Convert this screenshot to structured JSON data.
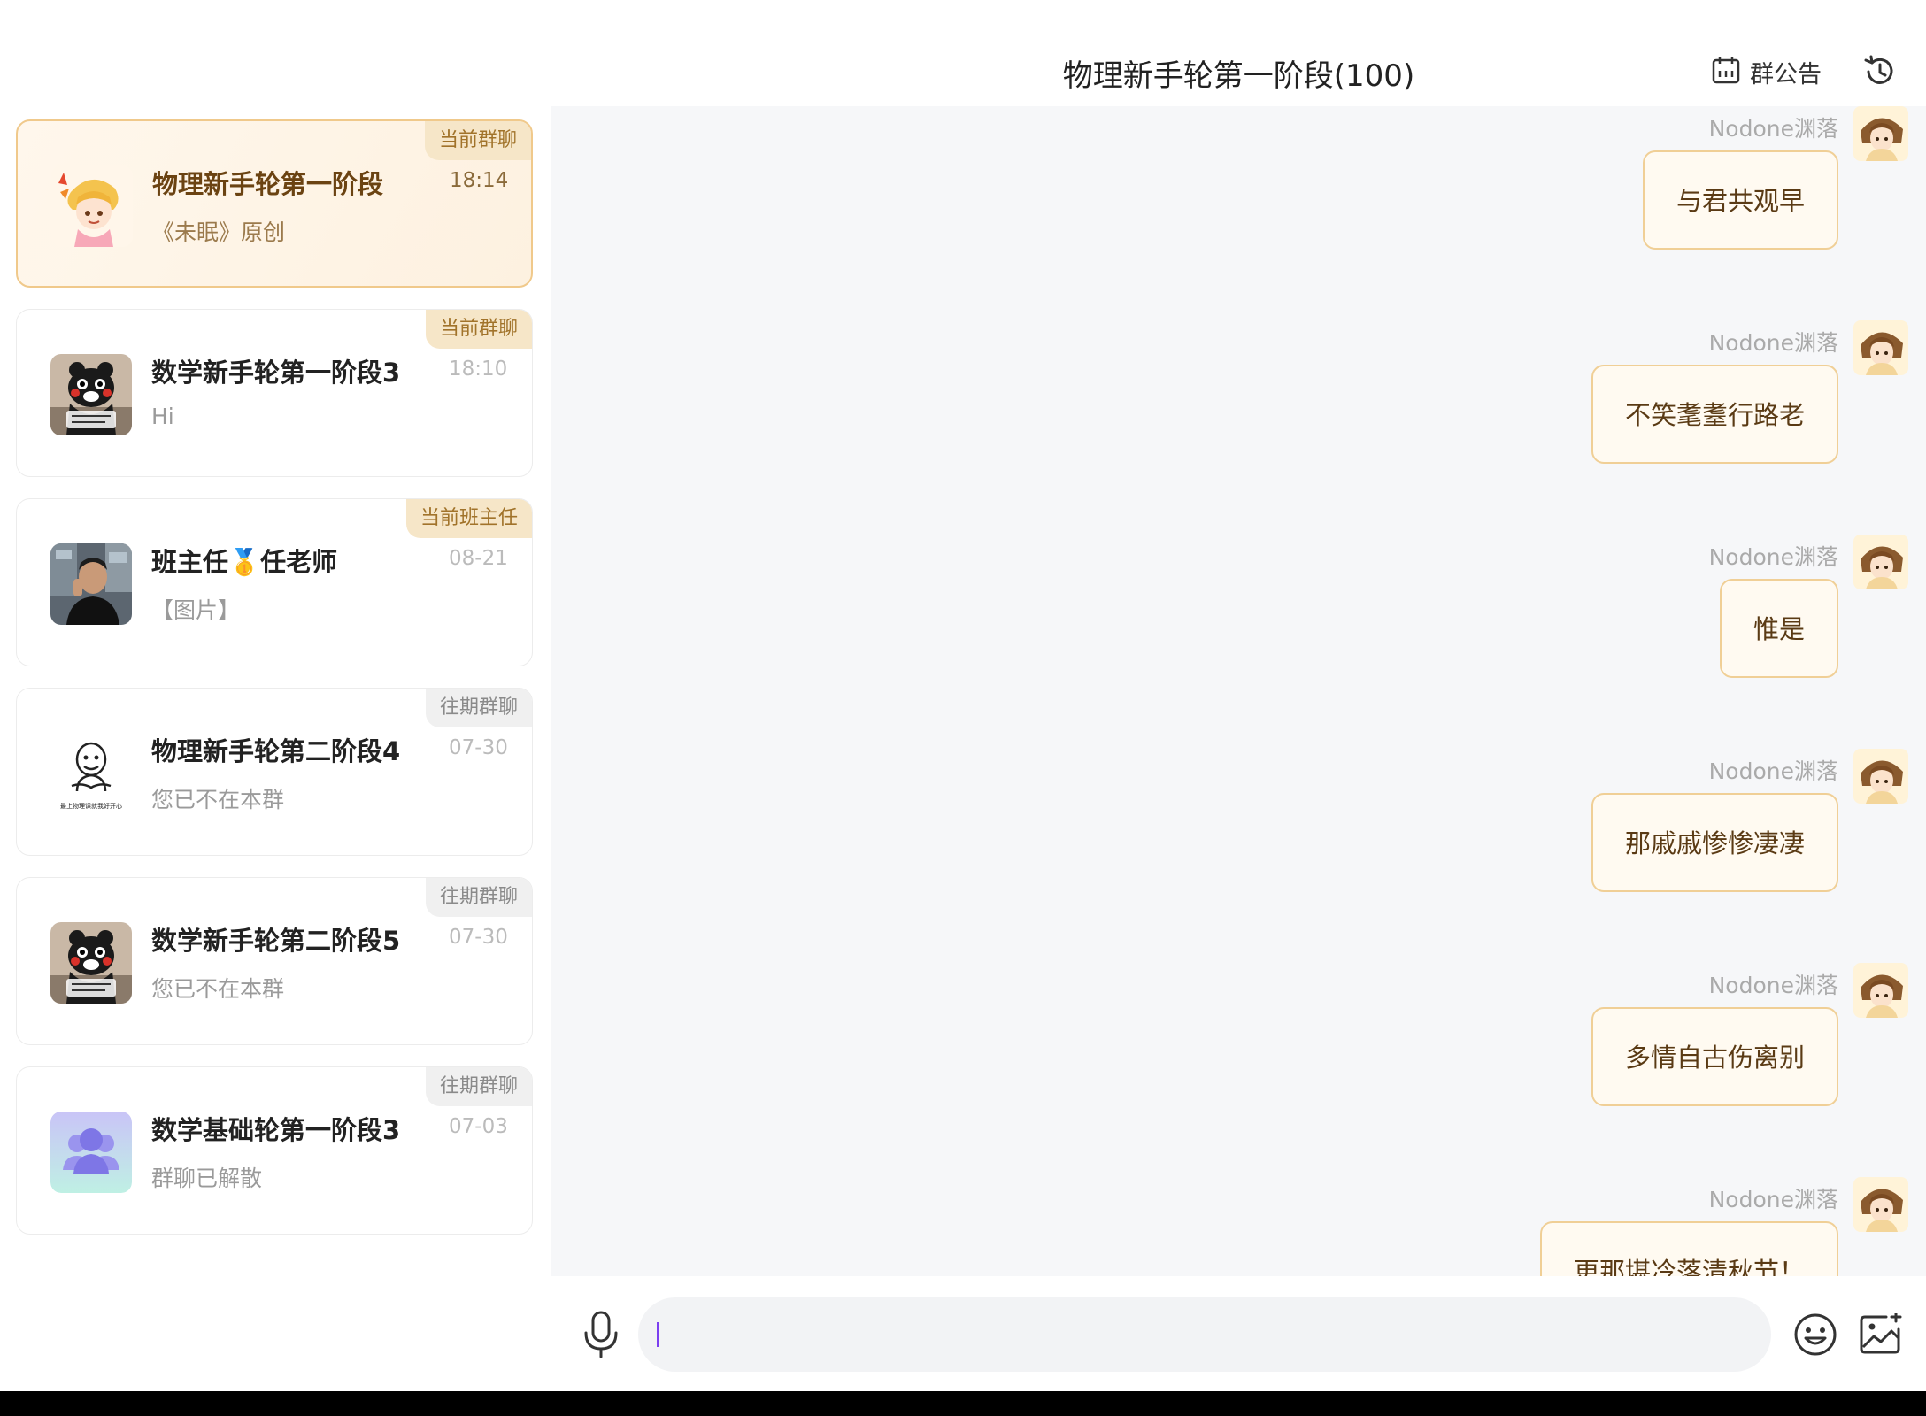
{
  "sidebar": {
    "conversations": [
      {
        "tag": "当前群聊",
        "tag_type": "current",
        "title": "物理新手轮第一阶段",
        "time": "18:14",
        "preview": "《未眠》原创",
        "avatar_icon": "anime-girl-avatar-icon",
        "active": true
      },
      {
        "tag": "当前群聊",
        "tag_type": "current",
        "title": "数学新手轮第一阶段3",
        "time": "18:10",
        "preview": "Hi",
        "avatar_icon": "kumamon-avatar-icon",
        "active": false
      },
      {
        "tag": "当前班主任",
        "tag_type": "current",
        "title": "班主任🥇任老师",
        "time": "08-21",
        "preview": "【图片】",
        "avatar_icon": "teacher-photo-avatar-icon",
        "active": false
      },
      {
        "tag": "往期群聊",
        "tag_type": "past",
        "title": "物理新手轮第二阶段4",
        "time": "07-30",
        "preview": "您已不在本群",
        "avatar_icon": "meme-sketch-avatar-icon",
        "avatar_caption": "最上物理课就我好开心",
        "active": false
      },
      {
        "tag": "往期群聊",
        "tag_type": "past",
        "title": "数学新手轮第二阶段5",
        "time": "07-30",
        "preview": "您已不在本群",
        "avatar_icon": "kumamon-avatar-icon",
        "active": false
      },
      {
        "tag": "往期群聊",
        "tag_type": "past",
        "title": "数学基础轮第一阶段3",
        "time": "07-03",
        "preview": "群聊已解散",
        "avatar_icon": "group-default-avatar-icon",
        "active": false
      }
    ]
  },
  "chat": {
    "title": "物理新手轮第一阶段(100)",
    "notice_label": "群公告",
    "messages": [
      {
        "sender": "Nodone渊落",
        "text": "与君共观早"
      },
      {
        "sender": "Nodone渊落",
        "text": "不笑耄耋行路老"
      },
      {
        "sender": "Nodone渊落",
        "text": "惟是"
      },
      {
        "sender": "Nodone渊落",
        "text": "那戚戚惨惨凄凄"
      },
      {
        "sender": "Nodone渊落",
        "text": "多情自古伤离别"
      },
      {
        "sender": "Nodone渊落",
        "text": "更那堪冷落清秋节！"
      }
    ],
    "input": {
      "value": "",
      "placeholder": ""
    }
  },
  "colors": {
    "accent_gold": "#f0cf96",
    "bubble_bg": "#fffaf1",
    "bubble_text": "#5a3a14",
    "tag_current_bg": "#f6e6c8",
    "tag_current_text": "#a1732a",
    "caret": "#7b3ff0"
  }
}
